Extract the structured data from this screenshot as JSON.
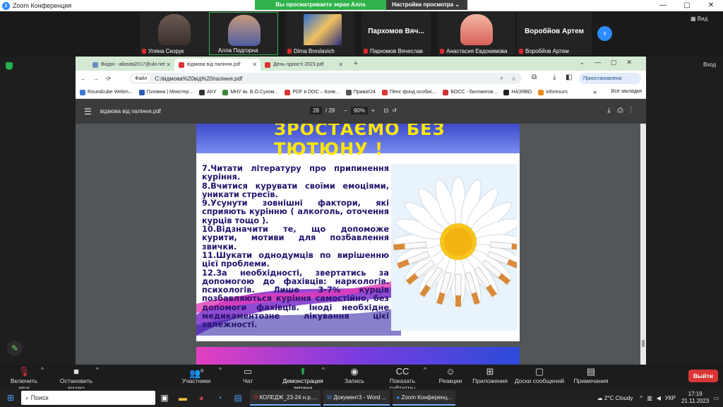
{
  "window": {
    "app_title": "Zoom Конференция"
  },
  "share_banner": {
    "text": "Вы просматриваете экран Алла Подгорна",
    "options": "Настройки просмотра"
  },
  "participants": [
    {
      "name": "Уляна Скорук"
    },
    {
      "name": "Алла Подгорна"
    },
    {
      "name": "Dima Breslavich"
    },
    {
      "name": "Пархомов Вячеслав",
      "display": "Пархомов Вяч..."
    },
    {
      "name": "Анастасия Евдокимова"
    },
    {
      "name": "Воробйов Артем",
      "display": "Воробйов Артем"
    }
  ],
  "view_label": "Вид",
  "view_label2": "Вход",
  "browser": {
    "tabs": [
      {
        "label": "Вхідні - allasita2017@ukr.net"
      },
      {
        "label": "відмова від паління.pdf"
      },
      {
        "label": "День гідності 2023.pdf"
      }
    ],
    "address": {
      "chip": "Файл",
      "url": "C:/відмова%20від%20паління.pdf"
    },
    "profile": "Приостановлена",
    "bookmarks": [
      "Roundcube Webm...",
      "Головна | Міністер...",
      "АКУ",
      "МНУ ім. В.О.Сухом...",
      "PDF в DOC – Конв...",
      "Приват24",
      "Пенс фонд особис...",
      "БОСС - биллингов...",
      "НАЗЯВО",
      "inforesurs"
    ],
    "all_bookmarks": "Все закладки"
  },
  "pdf": {
    "title": "відмова від паління.pdf",
    "page": "28",
    "pages": "/ 29",
    "zoom": "90%",
    "slide_heading": "ЗРОСТАЄМО БЕЗ ТЮТЮНУ !",
    "slide_items": [
      "7.Читати літературу про припинення куріння.",
      "8.Вчитися курувати своїми емоціями, уникати стресів.",
      "9.Усунути зовнішні фактори, які сприяють курінню ( алкоголь, оточення курців тощо ).",
      "10.Відзначити те, що допоможе курити, мотиви для позбавлення звички.",
      "11.Шукати однодумців по вирішенню цієї проблеми.",
      "12.За необхідності, звертатись за допомогою до фахівців: наркологів. психологів. Лише 3-7% курців позбавляються куріння самостійно, без допомоги фахівців. Іноді необхідне медикаментозне лікування цієї залежності."
    ]
  },
  "toolbar": {
    "mute": "Включить звук",
    "video": "Остановить видео",
    "participants": "Участники",
    "participants_count": "8",
    "chat": "Чат",
    "share": "Демонстрация экрана",
    "record": "Запись",
    "captions": "Показать субтитры",
    "reactions": "Реакции",
    "apps": "Приложения",
    "whiteboards": "Доски сообщений",
    "notes": "Примечания",
    "exit": "Выйти"
  },
  "taskbar": {
    "search": "Поиск",
    "apps": [
      "КОЛЕДЖ_23-24 н.р....",
      "Документ3 - Word ...",
      "Zoom Конференц..."
    ],
    "weather": "2°C  Cloudy",
    "lang": "УКР",
    "time": "17:19",
    "date": "21.11.2023"
  }
}
